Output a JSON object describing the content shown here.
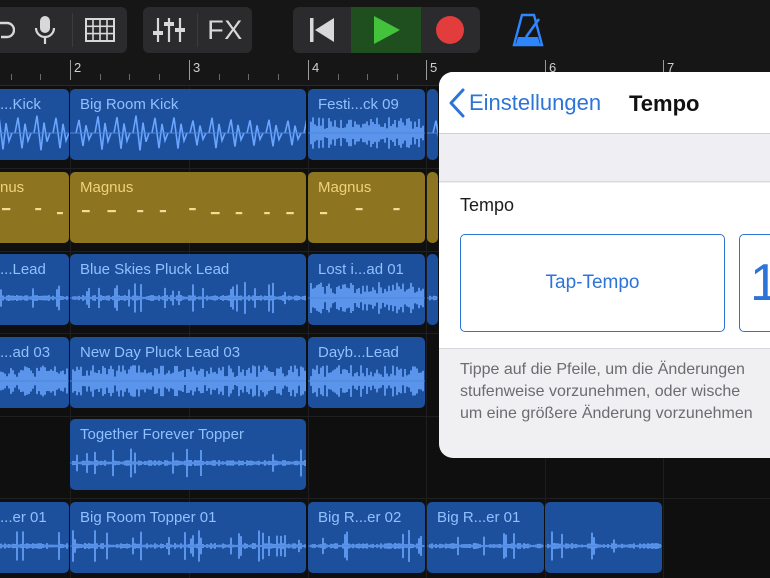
{
  "toolbar": {
    "icons": [
      "loop-icon",
      "microphone-icon",
      "grid-icon",
      "mixer-icon",
      "fx-button",
      "rewind-icon",
      "play-icon",
      "record-icon",
      "metronome-icon"
    ],
    "fx_label": "FX",
    "colors": {
      "play": "#44c23c",
      "record": "#e23c3c",
      "metronome": "#2e86ff"
    }
  },
  "ruler": {
    "bars": [
      "2",
      "3",
      "4",
      "5",
      "6",
      "7"
    ]
  },
  "tracks": [
    {
      "color": "blue",
      "regions": [
        {
          "label": "...Kick"
        },
        {
          "label": "Big Room Kick"
        },
        {
          "label": "Festi...ck 09"
        },
        {
          "label": ""
        }
      ]
    },
    {
      "color": "gold",
      "regions": [
        {
          "label": "nus"
        },
        {
          "label": "Magnus"
        },
        {
          "label": "Magnus"
        },
        {
          "label": ""
        }
      ]
    },
    {
      "color": "blue",
      "regions": [
        {
          "label": "...Lead"
        },
        {
          "label": "Blue Skies Pluck Lead"
        },
        {
          "label": "Lost i...ad 01"
        },
        {
          "label": ""
        }
      ]
    },
    {
      "color": "blue",
      "regions": [
        {
          "label": "...ad 03"
        },
        {
          "label": "New Day Pluck Lead 03"
        },
        {
          "label": "Dayb...Lead"
        }
      ]
    },
    {
      "color": "blue",
      "regions": [
        {
          "label": "Together Forever Topper"
        }
      ]
    },
    {
      "color": "blue",
      "regions": [
        {
          "label": "...er 01"
        },
        {
          "label": "Big Room Topper 01"
        },
        {
          "label": "Big R...er 02"
        },
        {
          "label": "Big R...er 01"
        },
        {
          "label": ""
        }
      ]
    }
  ],
  "popover": {
    "back_label": "Einstellungen",
    "title": "Tempo",
    "section_label": "Tempo",
    "tap_tempo_label": "Tap-Tempo",
    "bpm_value": "1",
    "help_lines": [
      "Tippe auf die Pfeile, um die Änderungen",
      "stufenweise vorzunehmen, oder wische",
      "um eine größere Änderung vorzunehmen"
    ],
    "accent_color": "#2d74d8"
  }
}
